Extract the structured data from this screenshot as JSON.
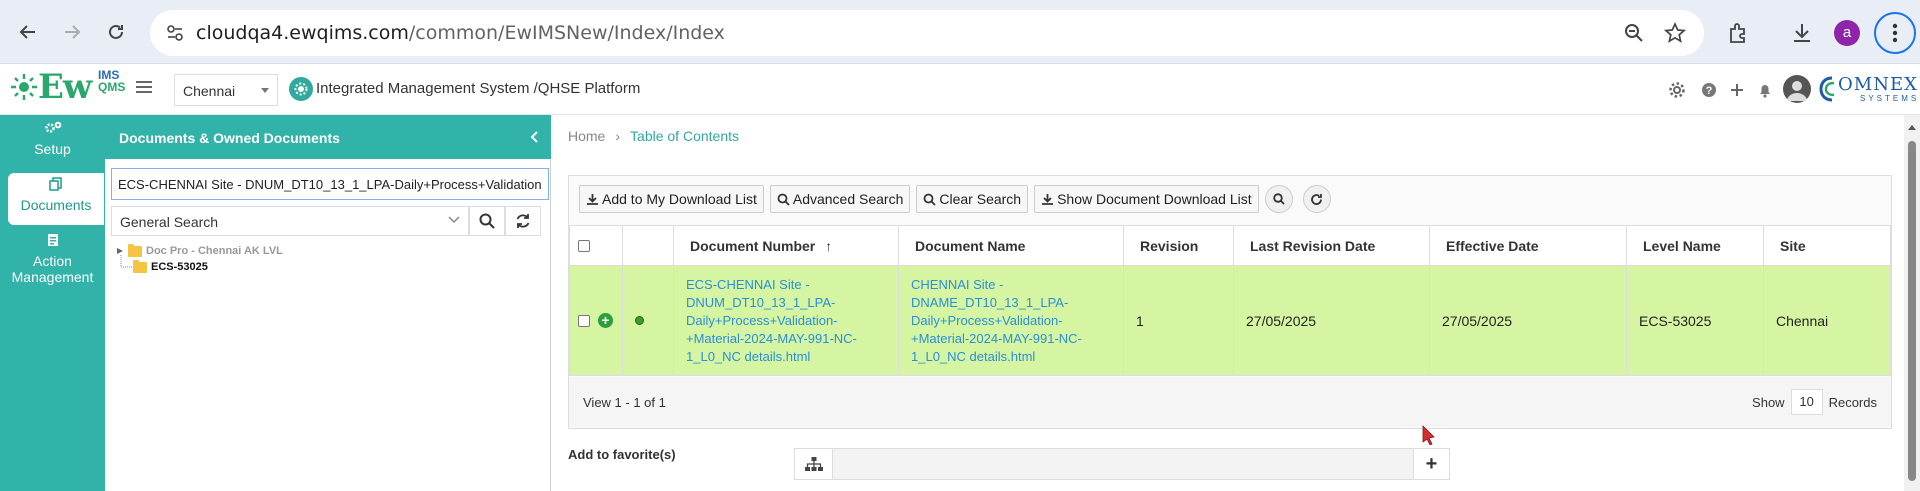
{
  "browser": {
    "url_host": "cloudqa4.ewqims.com",
    "url_path": "/common/EwIMSNew/Index/Index",
    "profile_initial": "a"
  },
  "header": {
    "logo_text": "Ew",
    "logo_sup": "IMS",
    "logo_sub": "QMS",
    "site": "Chennai",
    "platform_title": "Integrated Management System /QHSE Platform",
    "brand": "OMNEX",
    "brand_sub": "SYSTEMS"
  },
  "leftnav": {
    "items": [
      {
        "label": "Setup",
        "icon": "gears-icon"
      },
      {
        "label": "Documents",
        "icon": "documents-icon"
      },
      {
        "label": "Action Management",
        "icon": "clipboard-icon"
      }
    ]
  },
  "docpanel": {
    "title": "Documents & Owned Documents",
    "search_value": "ECS-CHENNAI Site - DNUM_DT10_13_1_LPA-Daily+Process+Validation",
    "search_type": "General Search",
    "tree": {
      "root": "Doc Pro - Chennai AK LVL",
      "child": "ECS-53025"
    }
  },
  "breadcrumb": {
    "home": "Home",
    "current": "Table of Contents"
  },
  "toolbar": {
    "download_list": "Add to My Download List",
    "advanced_search": "Advanced Search",
    "clear_search": "Clear Search",
    "show_download": "Show Document Download List"
  },
  "grid": {
    "columns": [
      "Document Number",
      "Document Name",
      "Revision",
      "Last Revision Date",
      "Effective Date",
      "Level Name",
      "Site"
    ],
    "rows": [
      {
        "document_number": "ECS-CHENNAI Site - DNUM_DT10_13_1_LPA-Daily+Process+Validation-+Material-2024-MAY-991-NC-1_L0_NC details.html",
        "document_name": "CHENNAI Site - DNAME_DT10_13_1_LPA-Daily+Process+Validation-+Material-2024-MAY-991-NC-1_L0_NC details.html",
        "revision": "1",
        "last_revision_date": "27/05/2025",
        "effective_date": "27/05/2025",
        "level_name": "ECS-53025",
        "site": "Chennai"
      }
    ],
    "view_text": "View 1 - 1 of 1",
    "show_label": "Show",
    "page_size": "10",
    "records_label": "Records"
  },
  "favorites": {
    "label": "Add to favorite(s)",
    "add": "+"
  },
  "colors": {
    "teal": "#31b3a9",
    "row_highlight": "#d6f5a3",
    "link": "#2a8fd6"
  }
}
